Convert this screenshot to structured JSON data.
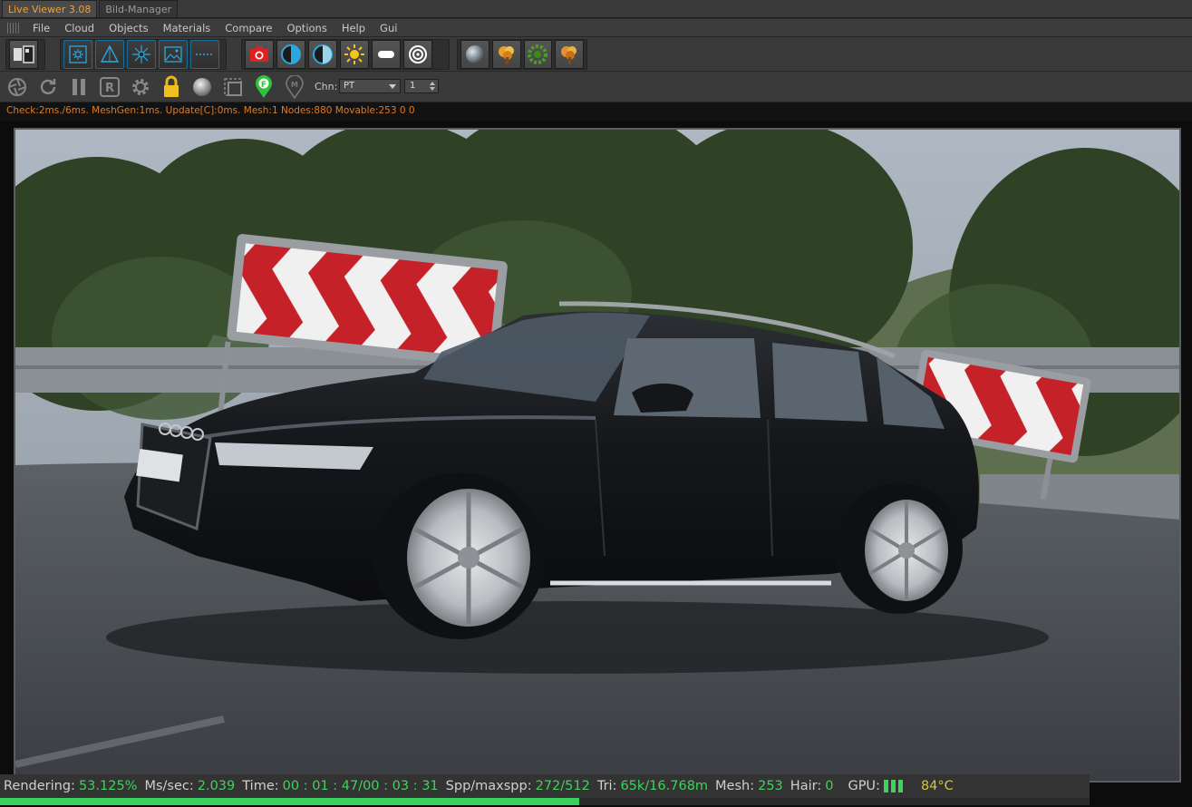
{
  "tabs": [
    {
      "label": "Live Viewer 3.08",
      "active": true
    },
    {
      "label": "Bild-Manager",
      "active": false
    }
  ],
  "menu": [
    "File",
    "Cloud",
    "Objects",
    "Materials",
    "Compare",
    "Options",
    "Help",
    "Gui"
  ],
  "toolbar1": {
    "icons": [
      "clone-view-icon",
      "settings-sun-icon",
      "triangle-icon",
      "sparkle-icon",
      "image-icon",
      "dotted-line-icon",
      "camera-icon",
      "contrast-icon",
      "contrast-alt-icon",
      "sun-icon",
      "light-bar-icon",
      "target-icon",
      "sphere-icon",
      "tree-icon",
      "tree-green-icon",
      "tree-orange-icon"
    ]
  },
  "toolbar2": {
    "channel_label": "Chn:",
    "channel_value": "PT",
    "spinner_value": "1",
    "icons": [
      "aperture-icon",
      "refresh-icon",
      "pause-icon",
      "r-icon",
      "gear-icon",
      "lock-icon",
      "ball-icon",
      "region-icon",
      "pin-f-icon",
      "pin-m-icon"
    ],
    "pin_f_letter": "F",
    "pin_m_letter": "M",
    "r_letter": "R"
  },
  "status_line": "Check:2ms./6ms. MeshGen:1ms. Update[C]:0ms. Mesh:1 Nodes:880 Movable:253  0 0",
  "render_stats": {
    "rendering_label": "Rendering:",
    "rendering_value": "53.125%",
    "mssec_label": "Ms/sec:",
    "mssec_value": "2.039",
    "time_label": "Time:",
    "time_value": "00 : 01 : 47/00 : 03 : 31",
    "spp_label": "Spp/maxspp:",
    "spp_value": "272/512",
    "tri_label": "Tri:",
    "tri_value": "65k/16.768m",
    "mesh_label": "Mesh:",
    "mesh_value": "253",
    "hair_label": "Hair:",
    "hair_value": "0",
    "gpu_label": "GPU:",
    "temp_value": "84°C",
    "progress_fraction": 0.53125
  },
  "colors": {
    "accent_orange": "#f0a030",
    "status_green": "#3dd45a",
    "status_cyan": "#5bc2e0",
    "temp_yellow": "#d7c43a",
    "status_line_orange": "#e07b1e"
  }
}
